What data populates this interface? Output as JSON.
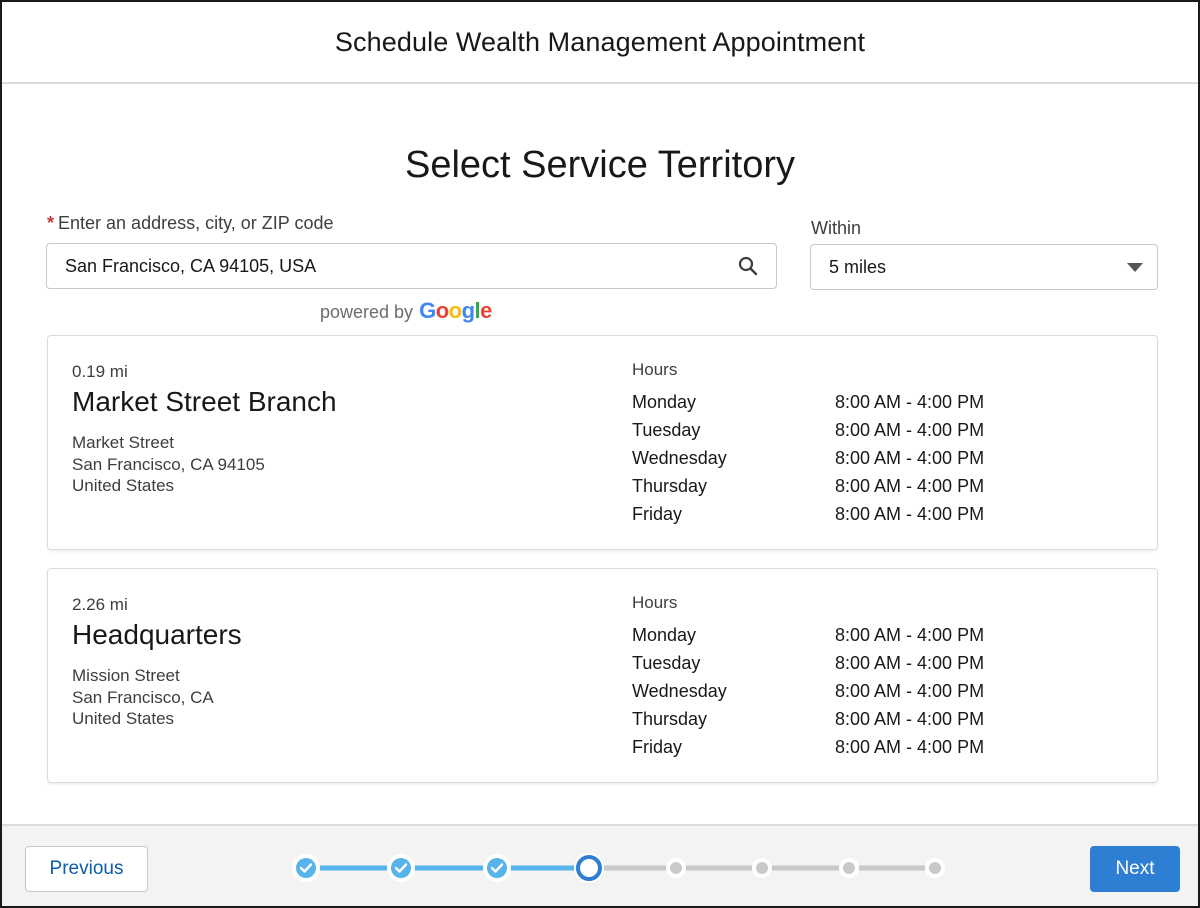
{
  "header": {
    "title": "Schedule Wealth Management Appointment"
  },
  "page": {
    "title": "Select Service Territory"
  },
  "address_field": {
    "required_marker": "*",
    "label": "Enter an address, city, or ZIP code",
    "value": "San Francisco, CA 94105, USA"
  },
  "powered_by": {
    "text": "powered by",
    "brand_letters": [
      {
        "char": "G",
        "color": "#4285F4"
      },
      {
        "char": "o",
        "color": "#EA4335"
      },
      {
        "char": "o",
        "color": "#FBBC05"
      },
      {
        "char": "g",
        "color": "#4285F4"
      },
      {
        "char": "l",
        "color": "#34A853"
      },
      {
        "char": "e",
        "color": "#EA4335"
      }
    ]
  },
  "within": {
    "label": "Within",
    "selected": "5 miles"
  },
  "territories": [
    {
      "distance": "0.19 mi",
      "name": "Market Street Branch",
      "address": [
        "Market Street",
        "San Francisco, CA 94105",
        "United States"
      ],
      "hours_label": "Hours",
      "hours": [
        {
          "day": "Monday",
          "time": "8:00 AM - 4:00 PM"
        },
        {
          "day": "Tuesday",
          "time": "8:00 AM - 4:00 PM"
        },
        {
          "day": "Wednesday",
          "time": "8:00 AM - 4:00 PM"
        },
        {
          "day": "Thursday",
          "time": "8:00 AM - 4:00 PM"
        },
        {
          "day": "Friday",
          "time": "8:00 AM - 4:00 PM"
        }
      ]
    },
    {
      "distance": "2.26 mi",
      "name": "Headquarters",
      "address": [
        "Mission Street",
        "San Francisco, CA",
        "United States"
      ],
      "hours_label": "Hours",
      "hours": [
        {
          "day": "Monday",
          "time": "8:00 AM - 4:00 PM"
        },
        {
          "day": "Tuesday",
          "time": "8:00 AM - 4:00 PM"
        },
        {
          "day": "Wednesday",
          "time": "8:00 AM - 4:00 PM"
        },
        {
          "day": "Thursday",
          "time": "8:00 AM - 4:00 PM"
        },
        {
          "day": "Friday",
          "time": "8:00 AM - 4:00 PM"
        }
      ]
    }
  ],
  "footer": {
    "previous_label": "Previous",
    "next_label": "Next",
    "progress": {
      "total_steps": 8,
      "current_step": 4,
      "completed_steps": 3
    }
  },
  "colors": {
    "accent": "#2e7ed3",
    "progress_complete": "#56b4ea",
    "progress_incomplete": "#c9c9c9",
    "required": "#c23934"
  },
  "icons": {
    "search": "search-icon",
    "dropdown": "chevron-down-icon",
    "completed_step": "check-icon"
  }
}
